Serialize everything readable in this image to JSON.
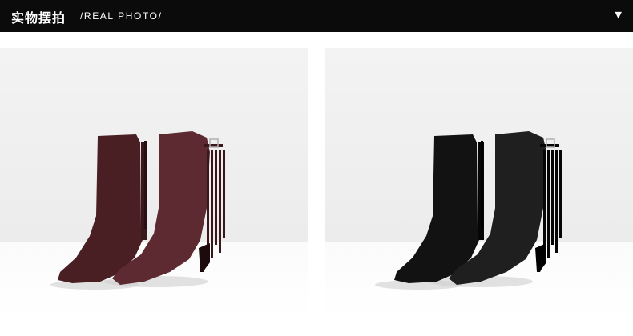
{
  "header": {
    "title_cn": "实物摆拍",
    "title_en": "/REAL PHOTO/",
    "toggle_icon": "triangle-down-icon"
  },
  "photos": [
    {
      "name": "burgundy-suede-fringe-ankle-boots",
      "color": "#4a1f24",
      "shade": "#3a171b",
      "accent": "#5c2a30"
    },
    {
      "name": "black-suede-fringe-ankle-boots",
      "color": "#121212",
      "shade": "#060606",
      "accent": "#1f1f1f"
    }
  ]
}
